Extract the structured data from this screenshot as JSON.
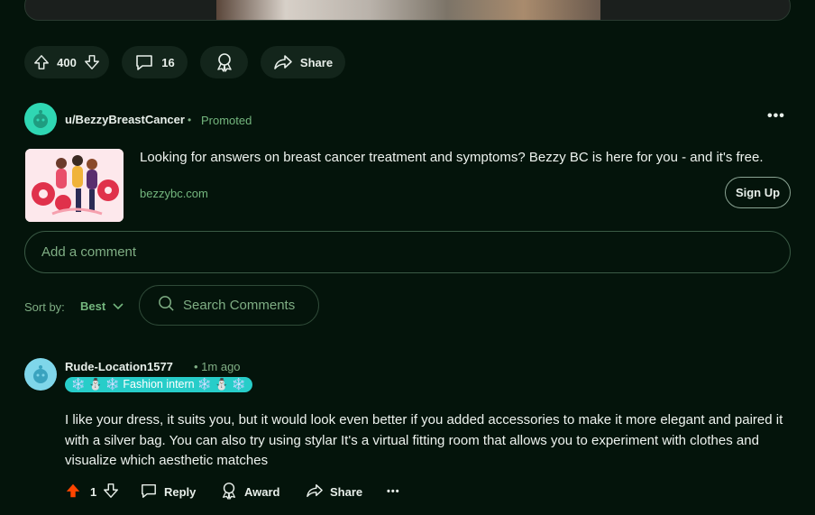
{
  "post_actions": {
    "vote_count": "400",
    "comment_count": "16",
    "share_label": "Share",
    "icons": [
      "upvote-icon",
      "downvote-icon",
      "comment-icon",
      "award-icon",
      "share-icon"
    ]
  },
  "ad": {
    "username": "u/BezzyBreastCancer",
    "separator": "•",
    "promoted_label": "Promoted",
    "more_label": "•••",
    "headline": "Looking for answers on breast cancer treatment and symptoms? Bezzy BC is here for you - and it's free.",
    "domain": "bezzybc.com",
    "cta_label": "Sign Up"
  },
  "comment_input": {
    "placeholder": "Add a comment"
  },
  "sort": {
    "label": "Sort by:",
    "value": "Best"
  },
  "search": {
    "placeholder": "Search Comments"
  },
  "comment": {
    "username": "Rude-Location1577",
    "time": "• 1m ago",
    "flair": "❄️ ⛄ ❄️ Fashion intern ❄️ ⛄ ❄️",
    "body": "I like your dress, it suits you, but it would look even better if you added accessories to make it more elegant and paired it with a silver bag. You can also try using stylar It's a virtual fitting room that allows you to experiment with clothes and visualize which aesthetic matches",
    "vote_count": "1",
    "reply_label": "Reply",
    "award_label": "Award",
    "share_label": "Share",
    "more_label": "•••"
  },
  "colors": {
    "background": "#04140b",
    "accent_green": "#74b67e",
    "upvote_active": "#ff4500",
    "flair_bg": "#27cdc9"
  }
}
